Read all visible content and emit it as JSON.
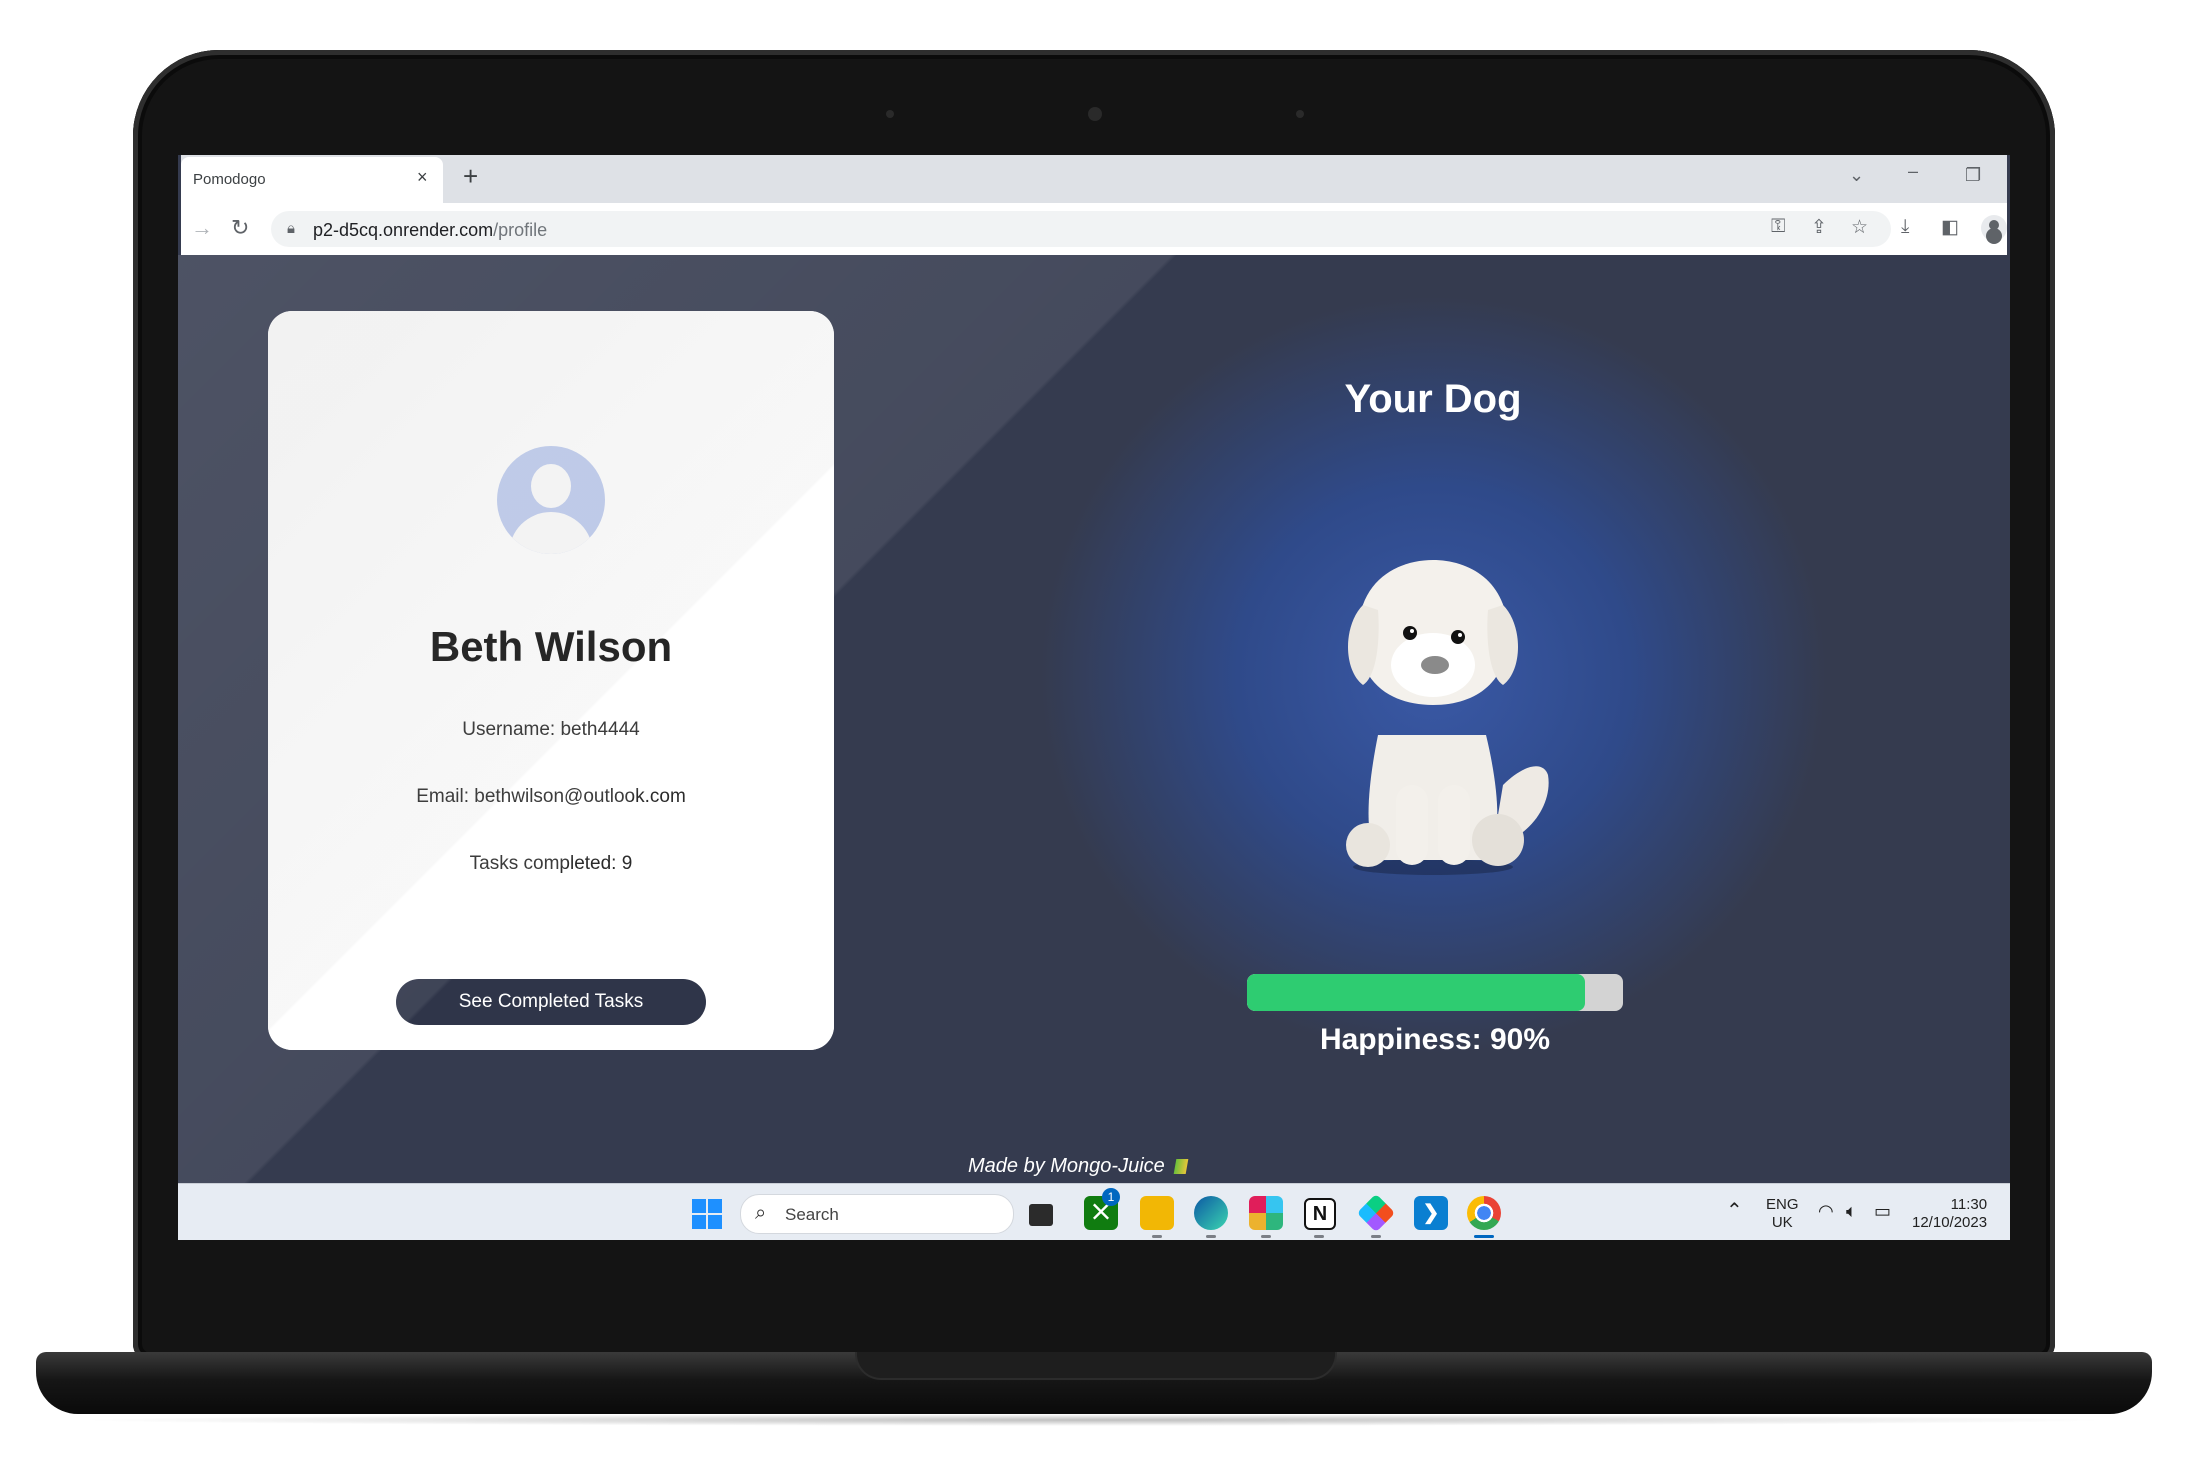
{
  "browser": {
    "tab_title": "Pomodogo",
    "close_glyph": "×",
    "new_tab_glyph": "+",
    "url_host": "p2-d5cq.onrender.com",
    "url_path": "/profile"
  },
  "profile": {
    "name": "Beth Wilson",
    "username_line": "Username: beth4444",
    "email_line": "Email: bethwilson@outlook.com",
    "tasks_line": "Tasks completed: 9",
    "button_label": "See Completed Tasks"
  },
  "dog": {
    "title": "Your Dog",
    "happiness_label": "Happiness: 90%",
    "happiness_fraction": 0.9
  },
  "footer": {
    "text": "Made by Mongo-Juice"
  },
  "taskbar": {
    "search_label": "Search",
    "badge_count": "1",
    "notion_glyph": "N",
    "lang_top": "ENG",
    "lang_bottom": "UK",
    "time": "11:30",
    "date": "12/10/2023"
  },
  "colors": {
    "page_bg": "#353b4f",
    "accent_glow": "#3a59a6",
    "button_bg": "#2f3549",
    "happiness_fill": "#2ecc71"
  },
  "icons": [
    "close-icon",
    "new-tab-icon",
    "chevron-down-icon",
    "minimize-icon",
    "restore-icon",
    "back-icon",
    "reload-icon",
    "lock-icon",
    "key-icon",
    "share-icon",
    "star-icon",
    "download-icon",
    "sidebar-icon",
    "profile-icon",
    "windows-start-icon",
    "search-icon",
    "task-view-icon",
    "xbox-icon",
    "file-explorer-icon",
    "edge-icon",
    "slack-icon",
    "notion-icon",
    "figma-icon",
    "vscode-icon",
    "chrome-icon",
    "chevron-up-icon",
    "wifi-icon",
    "volume-icon",
    "battery-icon"
  ]
}
